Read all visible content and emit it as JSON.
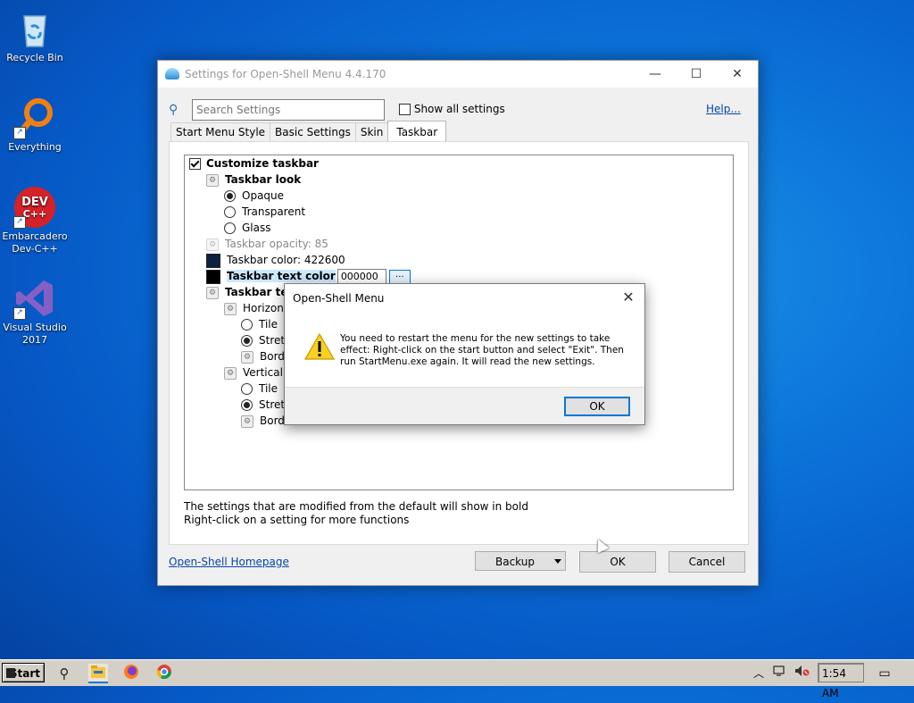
{
  "desktop": {
    "icons": [
      {
        "label": "Recycle Bin"
      },
      {
        "label": "Everything"
      },
      {
        "label": "Embarcadero Dev-C++",
        "logo_text": "DEV C++"
      },
      {
        "label": "Visual Studio 2017"
      }
    ]
  },
  "window": {
    "title": "Settings for Open-Shell Menu 4.4.170",
    "minimize": "—",
    "maximize": "☐",
    "close": "✕",
    "search_placeholder": "Search Settings",
    "show_all_label": "Show all settings",
    "help_label": "Help...",
    "tabs": [
      {
        "label": "Start Menu Style"
      },
      {
        "label": "Basic Settings"
      },
      {
        "label": "Skin"
      },
      {
        "label": "Taskbar",
        "active": true
      }
    ],
    "tree": {
      "customize_taskbar": "Customize taskbar",
      "taskbar_look": "Taskbar look",
      "opaque": "Opaque",
      "transparent": "Transparent",
      "glass": "Glass",
      "opacity": "Taskbar opacity: 85",
      "taskbar_color": "Taskbar color: 422600",
      "taskbar_color_hex": "#0b2240",
      "text_color_label": "Taskbar text color",
      "text_color_value": "000000",
      "text_color_hex": "#000000",
      "dots": "...",
      "taskbar_texture": "Taskbar text",
      "horizontal": "Horizonta",
      "h_tile": "Tile",
      "h_stretch": "Stretc",
      "h_border": "Borde",
      "vertical": "Vertical st",
      "v_tile": "Tile",
      "v_stretch": "Stretc",
      "v_border": "Borde"
    },
    "info_line1": "The settings that are modified from the default will show in bold",
    "info_line2": "Right-click on a setting for more functions",
    "homepage": "Open-Shell Homepage",
    "backup": "Backup",
    "ok": "OK",
    "cancel": "Cancel"
  },
  "dialog": {
    "title": "Open-Shell Menu",
    "close": "✕",
    "message": "You need to restart the menu for the new settings to take effect: Right-click on the start button and select \"Exit\". Then run StartMenu.exe again. It will read the new settings.",
    "ok": "OK"
  },
  "taskbar": {
    "start": "Start",
    "clock": "1:54 AM",
    "search_icon": "⚲",
    "tray_up": "︿",
    "notification_icon": "▭"
  },
  "colors": {
    "accent": "#0078d7",
    "link": "#0645ad",
    "taskbar": "#d4d0c8"
  }
}
